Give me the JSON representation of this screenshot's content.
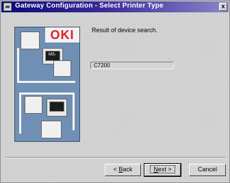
{
  "window": {
    "title": "Gateway Configuration - Select Printer Type",
    "close_glyph": "x"
  },
  "illustration": {
    "logo_text": "OKI",
    "monitor_text": "MS-"
  },
  "content": {
    "result_label": "Result of device search.",
    "printer_value": "C7200"
  },
  "buttons": {
    "back": {
      "prefix": "< ",
      "accel": "B",
      "rest": "ack"
    },
    "next": {
      "accel": "N",
      "rest": "ext >"
    },
    "cancel": "Cancel"
  },
  "colors": {
    "title_start": "#0a0a7a",
    "title_end": "#8a86c8",
    "logo_red": "#e01d2a",
    "art_blue": "#6f8fb4"
  }
}
